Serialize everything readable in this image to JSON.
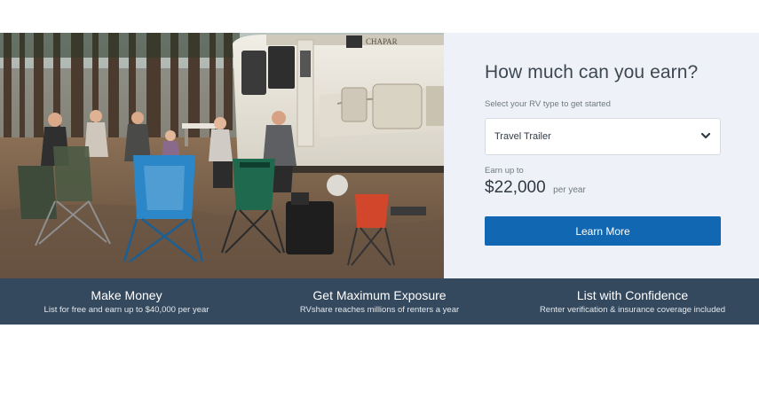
{
  "hero": {
    "title": "How much can you earn?",
    "subtitle": "Select your RV type to get started",
    "rv_type_select": {
      "value": "Travel Trailer",
      "icon": "chevron-down-icon"
    },
    "earn_label": "Earn up to",
    "earn_amount": "$22,000",
    "earn_unit": "per year",
    "cta_label": "Learn More",
    "colors": {
      "panel_bg": "#eef2f8",
      "button": "#1167b1",
      "strip": "#34495e"
    }
  },
  "features": [
    {
      "title": "Make Money",
      "description": "List for free and earn up to $40,000 per year"
    },
    {
      "title": "Get Maximum Exposure",
      "description": "RVshare reaches millions of renters a year"
    },
    {
      "title": "List with Confidence",
      "description": "Renter verification & insurance coverage included"
    }
  ]
}
